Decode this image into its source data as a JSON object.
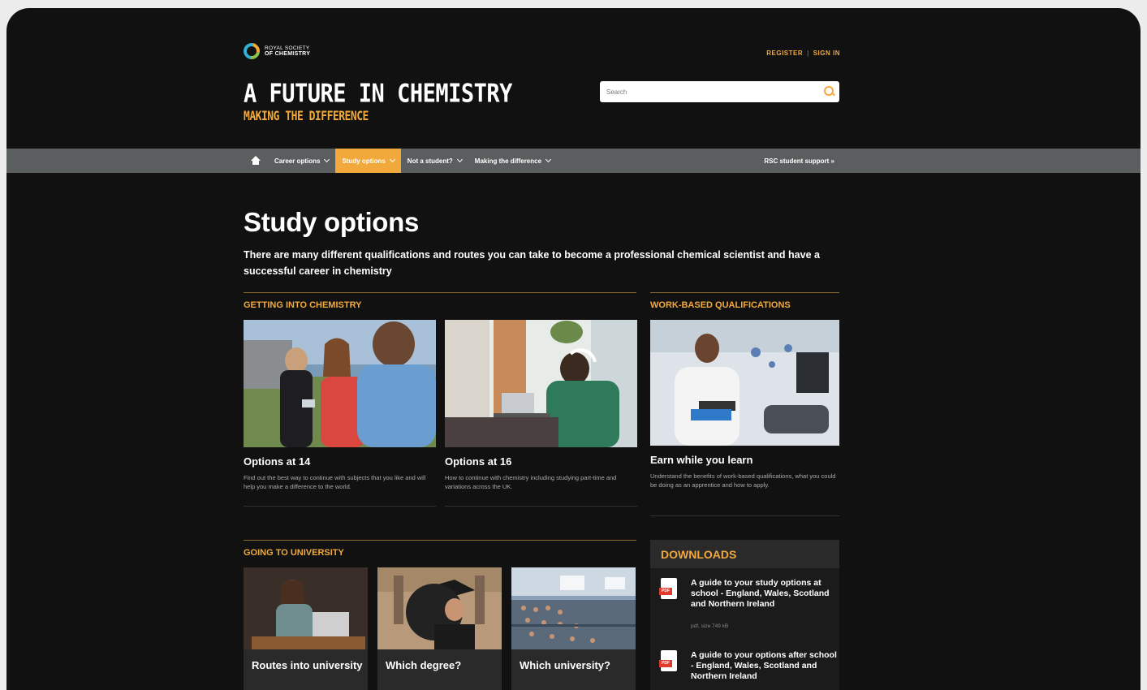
{
  "header": {
    "logo_line1": "ROYAL SOCIETY",
    "logo_line2": "OF CHEMISTRY",
    "register": "REGISTER",
    "sign_in": "SIGN IN",
    "site_title": "A FUTURE IN CHEMISTRY",
    "site_subtitle": "MAKING THE DIFFERENCE",
    "search_placeholder": "Search"
  },
  "nav": {
    "items": [
      {
        "label": "Career options"
      },
      {
        "label": "Study options"
      },
      {
        "label": "Not a student?"
      },
      {
        "label": "Making the difference"
      }
    ],
    "active": "Study options",
    "support": "RSC student support »"
  },
  "main": {
    "title": "Study options",
    "intro": "There are many different qualifications and routes you can take to become a professional chemical scientist and have a successful career in chemistry",
    "sections": {
      "getting_into": "GETTING INTO CHEMISTRY",
      "work_based": "WORK-BASED QUALIFICATIONS",
      "university": "GOING TO UNIVERSITY"
    },
    "cards": [
      {
        "title": "Options at 14",
        "desc": "Find out the best way to continue with subjects that you like and will help you make a difference to the world."
      },
      {
        "title": "Options at 16",
        "desc": "How to continue with chemistry including studying part-time and variations across the UK."
      },
      {
        "title": "Earn while you learn",
        "desc": "Understand the benefits of work-based qualifications, what you could be doing as an apprentice and how to apply."
      }
    ],
    "uni_cards": [
      {
        "title": "Routes into university"
      },
      {
        "title": "Which degree?"
      },
      {
        "title": "Which university?"
      }
    ]
  },
  "downloads": {
    "heading": "DOWNLOADS",
    "items": [
      {
        "title": "A guide to your study options at school - England, Wales, Scotland and Northern Ireland",
        "meta": "pdf, size 749 kB"
      },
      {
        "title": "A guide to your options after school - England, Wales, Scotland and Northern Ireland",
        "meta": ""
      }
    ]
  },
  "colors": {
    "accent": "#f2a93b",
    "background": "#111111",
    "nav": "#5b5e5f"
  }
}
